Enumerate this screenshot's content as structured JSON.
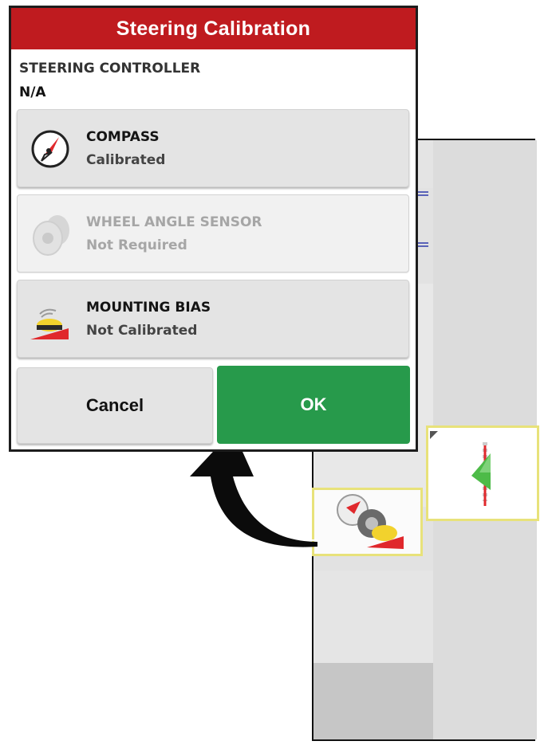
{
  "dialog": {
    "title": "Steering Calibration",
    "controller_label": "STEERING CONTROLLER",
    "controller_value": "N/A",
    "items": [
      {
        "title": "COMPASS",
        "status": "Calibrated",
        "icon": "compass-icon",
        "enabled": true
      },
      {
        "title": "WHEEL ANGLE SENSOR",
        "status": "Not Required",
        "icon": "wheel-sensor-icon",
        "enabled": false
      },
      {
        "title": "MOUNTING BIAS",
        "status": "Not Calibrated",
        "icon": "mounting-bias-icon",
        "enabled": true
      }
    ],
    "cancel_label": "Cancel",
    "ok_label": "OK"
  },
  "colors": {
    "title_bar": "#bf1b1f",
    "ok_button": "#279a4b",
    "tile_highlight": "#e8e27a"
  },
  "background_tiles": [
    {
      "icon": "steering-guidance-icon"
    },
    {
      "icon": "steering-calibration-icon"
    }
  ]
}
